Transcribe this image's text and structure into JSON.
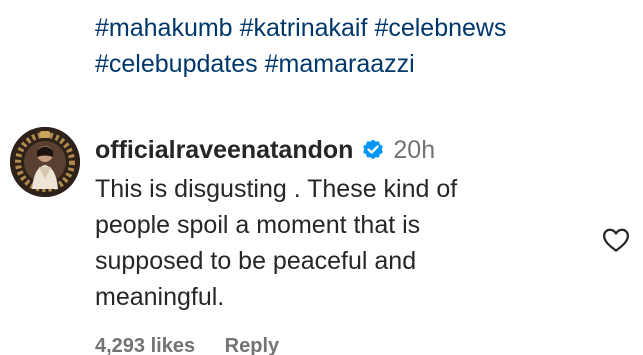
{
  "post": {
    "hashtags_line1": [
      "#mahakumb",
      "#katrinakaif",
      "#celebnews"
    ],
    "hashtags_line2": [
      "#celebupdates",
      "#mamaraazzi"
    ]
  },
  "comment": {
    "username": "officialraveenatandon",
    "verified_icon": "verified-badge-icon",
    "time": "20h",
    "text": "This is disgusting . These kind of people spoil a moment that is supposed to be peaceful and meaningful.",
    "likes": "4,293 likes",
    "reply_label": "Reply",
    "like_icon": "heart-outline-icon"
  },
  "colors": {
    "hashtag": "#00376b",
    "verified": "#0095f6",
    "muted": "#737373",
    "text": "#262626"
  }
}
